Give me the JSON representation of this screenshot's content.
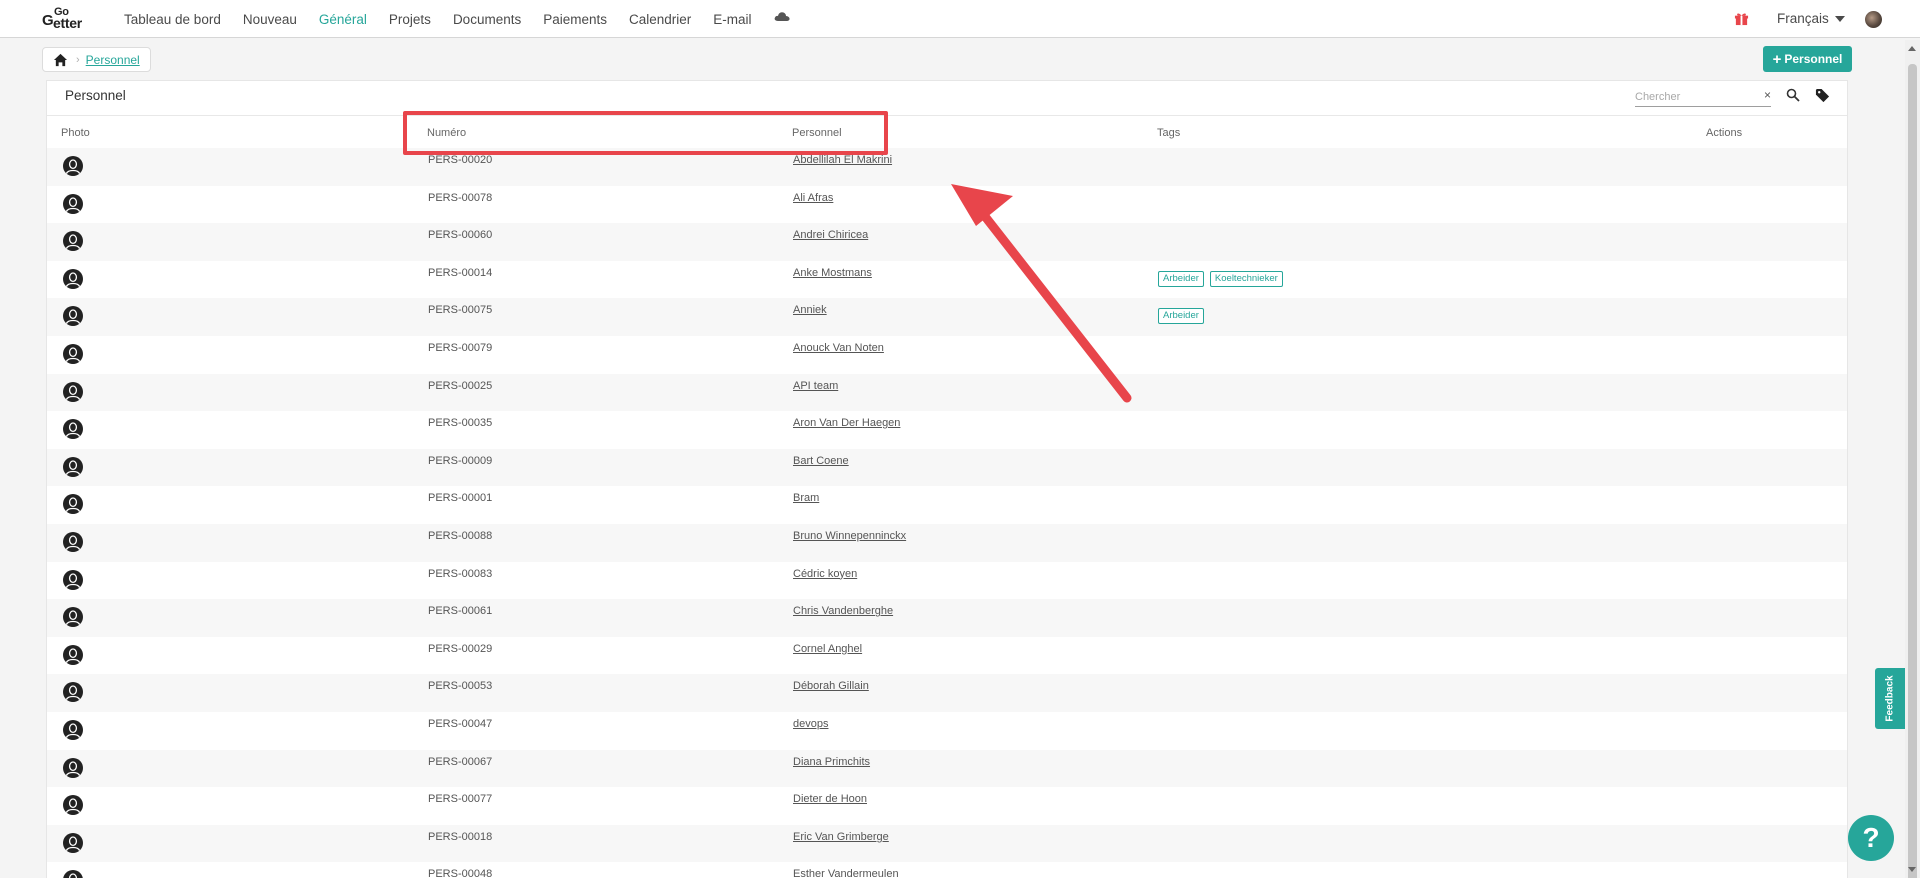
{
  "app": {
    "logo_top": "Go",
    "logo_g": "G",
    "logo_bottom": "etter"
  },
  "nav": {
    "items": [
      {
        "label": "Tableau de bord",
        "active": false
      },
      {
        "label": "Nouveau",
        "active": false
      },
      {
        "label": "Général",
        "active": true
      },
      {
        "label": "Projets",
        "active": false
      },
      {
        "label": "Documents",
        "active": false
      },
      {
        "label": "Paiements",
        "active": false
      },
      {
        "label": "Calendrier",
        "active": false
      },
      {
        "label": "E-mail",
        "active": false
      }
    ],
    "cloud_icon": "cloud-icon",
    "gift_icon": "gift-icon",
    "language": "Français"
  },
  "breadcrumb": {
    "home_icon": "home-icon",
    "current": "Personnel"
  },
  "add_button": {
    "label": "Personnel",
    "icon": "plus-icon"
  },
  "card": {
    "title": "Personnel",
    "search": {
      "placeholder": "Chercher",
      "value": ""
    },
    "clear_label": "×"
  },
  "table": {
    "columns": [
      "Photo",
      "Numéro",
      "Personnel",
      "Tags",
      "Actions"
    ],
    "rows": [
      {
        "number": "PERS-00020",
        "name": "Abdellilah El Makrini",
        "tags": []
      },
      {
        "number": "PERS-00078",
        "name": "Ali Afras",
        "tags": []
      },
      {
        "number": "PERS-00060",
        "name": "Andrei Chiricea",
        "tags": []
      },
      {
        "number": "PERS-00014",
        "name": "Anke Mostmans",
        "tags": [
          "Arbeider",
          "Koeltechnieker"
        ]
      },
      {
        "number": "PERS-00075",
        "name": "Anniek",
        "tags": [
          "Arbeider"
        ]
      },
      {
        "number": "PERS-00079",
        "name": "Anouck Van Noten",
        "tags": []
      },
      {
        "number": "PERS-00025",
        "name": "API team",
        "tags": []
      },
      {
        "number": "PERS-00035",
        "name": "Aron Van Der Haegen",
        "tags": []
      },
      {
        "number": "PERS-00009",
        "name": "Bart Coene",
        "tags": []
      },
      {
        "number": "PERS-00001",
        "name": "Bram",
        "tags": []
      },
      {
        "number": "PERS-00088",
        "name": "Bruno Winnepenninckx",
        "tags": []
      },
      {
        "number": "PERS-00083",
        "name": "Cédric koyen",
        "tags": []
      },
      {
        "number": "PERS-00061",
        "name": "Chris Vandenberghe",
        "tags": []
      },
      {
        "number": "PERS-00029",
        "name": "Cornel Anghel",
        "tags": []
      },
      {
        "number": "PERS-00053",
        "name": "Déborah Gillain",
        "tags": []
      },
      {
        "number": "PERS-00047",
        "name": "devops",
        "tags": []
      },
      {
        "number": "PERS-00067",
        "name": "Diana Primchits",
        "tags": []
      },
      {
        "number": "PERS-00077",
        "name": "Dieter de Hoon",
        "tags": []
      },
      {
        "number": "PERS-00018",
        "name": "Eric Van Grimberge",
        "tags": []
      },
      {
        "number": "PERS-00048",
        "name": "Esther Vandermeulen",
        "tags": []
      }
    ]
  },
  "feedback": {
    "label": "Feedback"
  },
  "help": {
    "label": "?"
  },
  "colors": {
    "accent": "#26a69a",
    "annotation": "#e8454b"
  }
}
